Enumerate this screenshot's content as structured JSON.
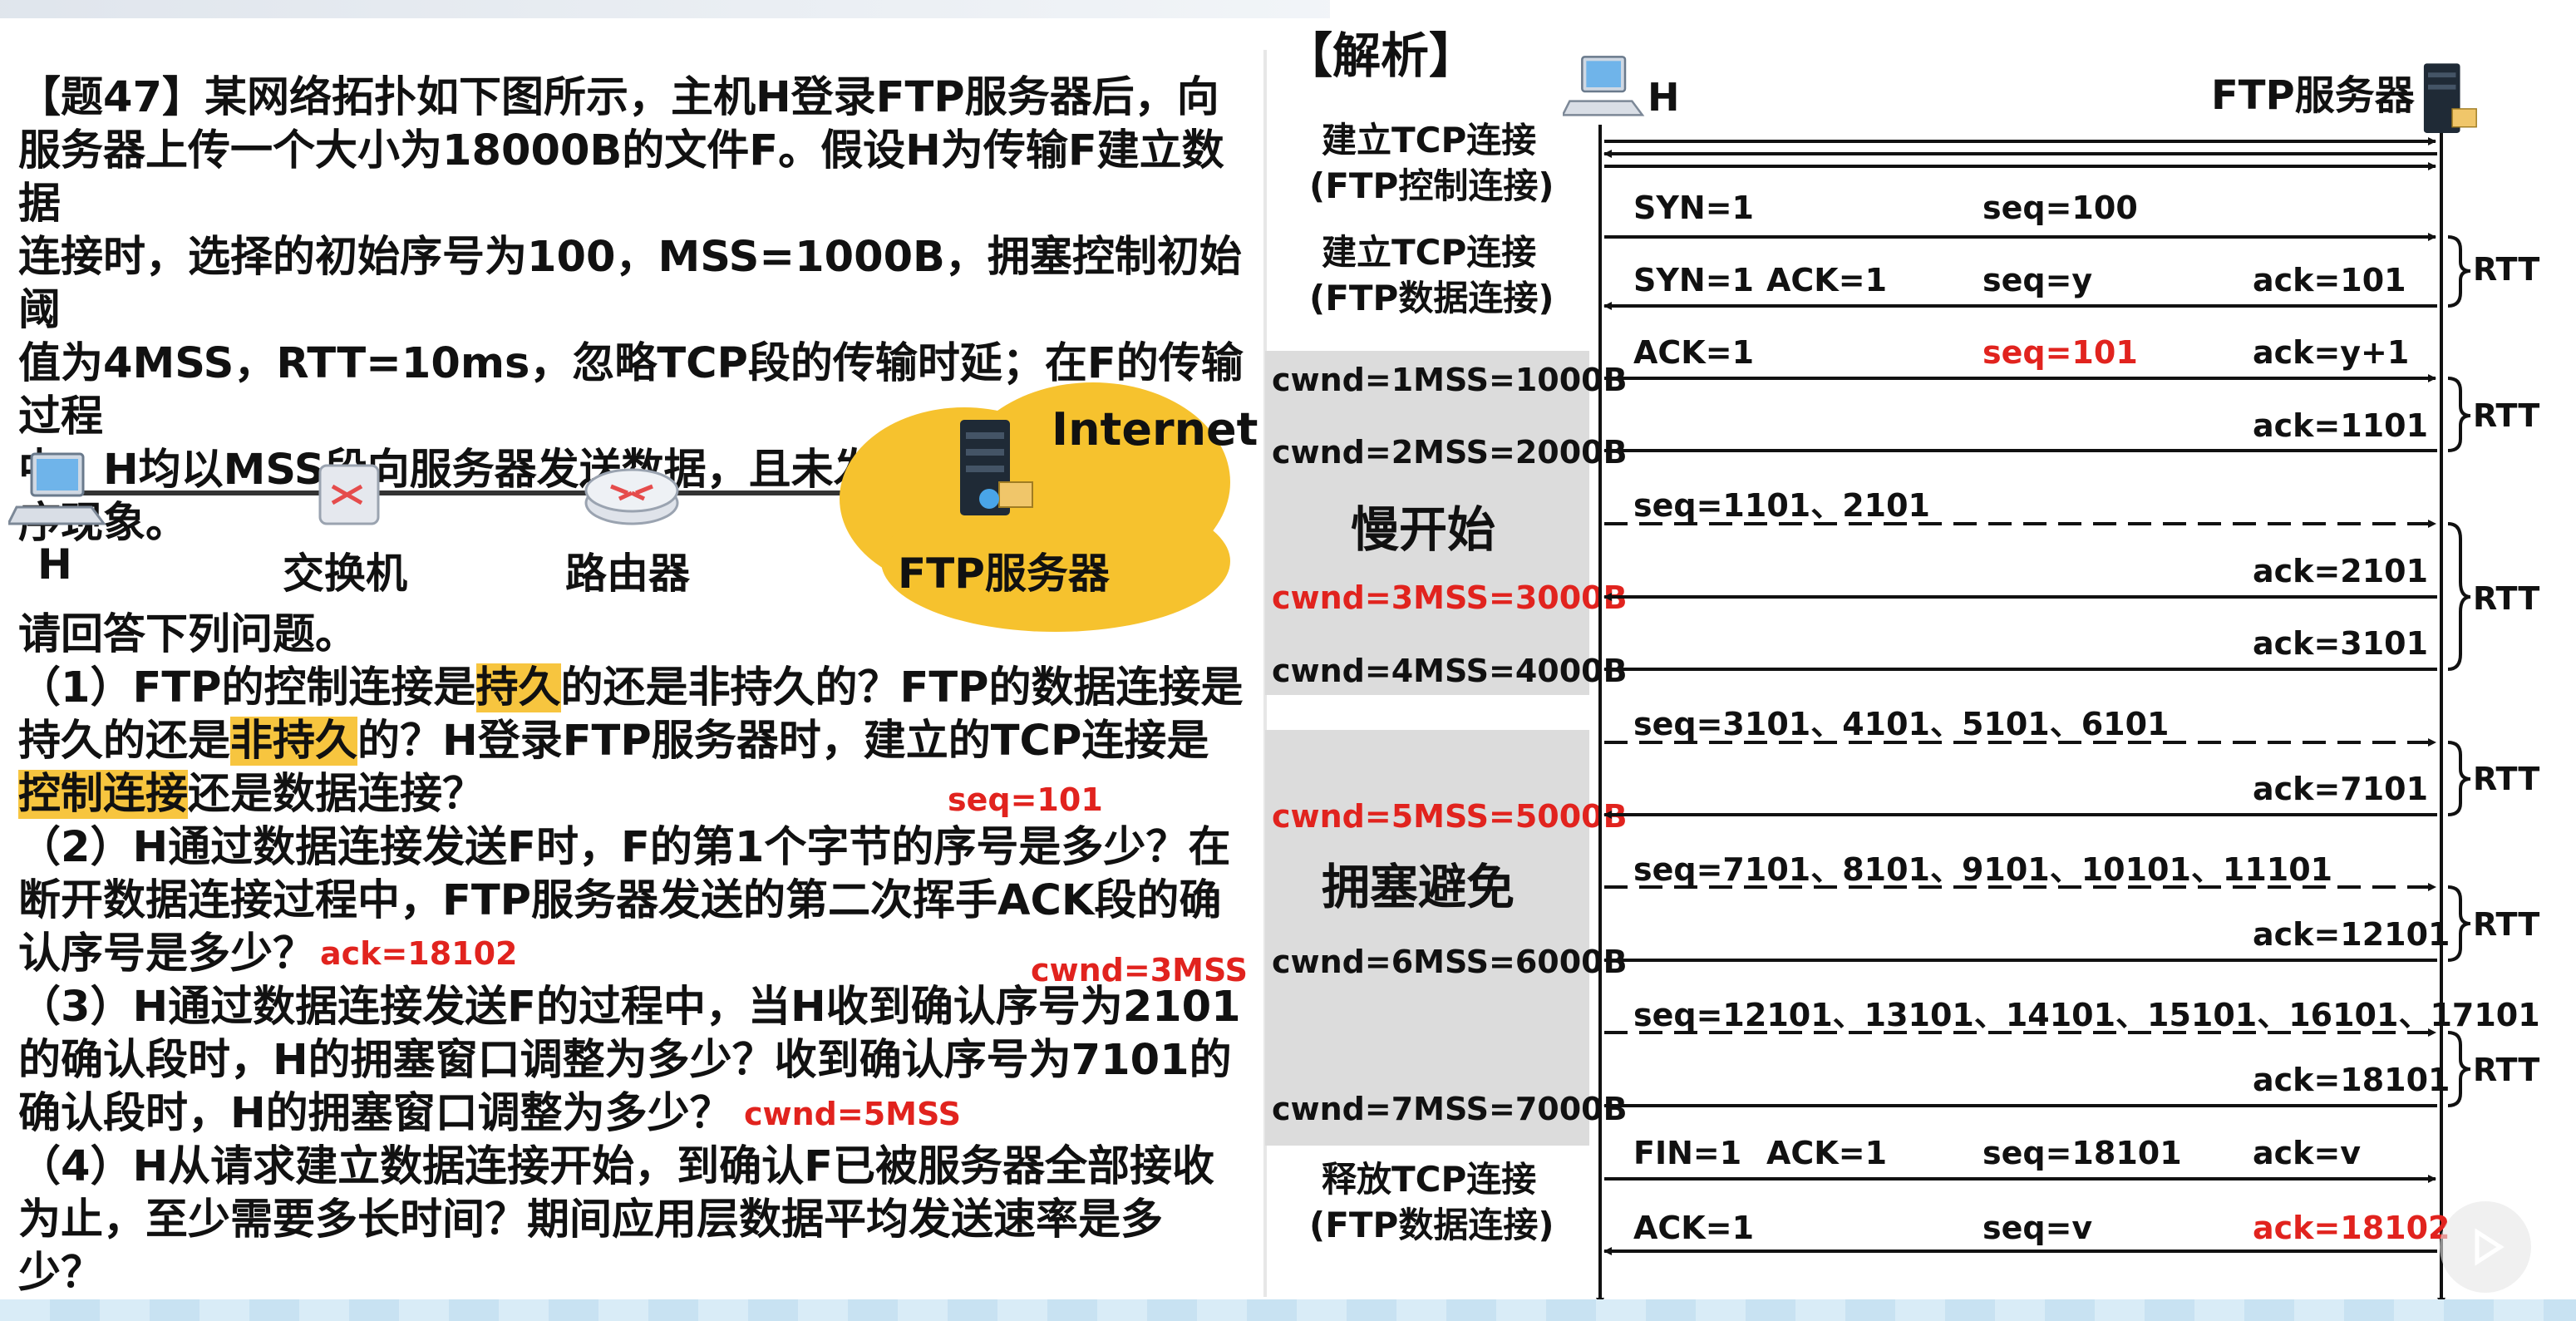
{
  "question": {
    "line1": "【题47】某网络拓扑如下图所示，主机H登录FTP服务器后，向",
    "line2": "服务器上传一个大小为18000B的文件F。假设H为传输F建立数据",
    "line3": "连接时，选择的初始序号为100，MSS=1000B，拥塞控制初始阈",
    "line4": "值为4MSS，RTT=10ms，忽略TCP段的传输时延；在F的传输过程",
    "line5": "中，H均以MSS段向服务器发送数据，且未发生差错、丢包和乱",
    "line6": "序现象。"
  },
  "topology": {
    "host_label": "H",
    "switch_label": "交换机",
    "router_label": "路由器",
    "internet_label": "Internet",
    "server_label": "FTP服务器"
  },
  "prompt": "请回答下列问题。",
  "q1": {
    "a": "（1）FTP的控制连接是",
    "b": "持久",
    "c": "的还是非持久的？FTP的数据连接是",
    "d": "持久的还是",
    "e": "非持久",
    "f": "的？H登录FTP服务器时，建立的TCP连接是",
    "g": "控制连接",
    "h": "还是数据连接？"
  },
  "q2": {
    "a": "（2）H通过数据连接发送F时，F的第1个字节的序号是多少？在",
    "b": "断开数据连接过程中，FTP服务器发送的第二次挥手ACK段的确",
    "c": "认序号是多少？"
  },
  "q3": {
    "a": "（3）H通过数据连接发送F的过程中，当H收到确认序号为2101",
    "b": "的确认段时，H的拥塞窗口调整为多少？收到确认序号为7101的",
    "c": "确认段时，H的拥塞窗口调整为多少？"
  },
  "q4": {
    "a": "（4）H从请求建立数据连接开始，到确认F已被服务器全部接收",
    "b": "为止，至少需要多长时间？期间应用层数据平均发送速率是多",
    "c": "少？"
  },
  "answers": {
    "seq": "seq=101",
    "ack": "ack=18102",
    "cwnd3": "cwnd=3MSS",
    "cwnd5": "cwnd=5MSS"
  },
  "analysis": {
    "title": "【解析】",
    "host": "H",
    "server": "FTP服务器",
    "ctrl_conn_1": "建立TCP连接",
    "ctrl_conn_2": "(FTP控制连接)",
    "data_conn_1": "建立TCP连接",
    "data_conn_2": "(FTP数据连接)",
    "release_1": "释放TCP连接",
    "release_2": "(FTP数据连接)",
    "slow_start": "慢开始",
    "cong_avoid": "拥塞避免",
    "rtt": "RTT",
    "cwnd": [
      "cwnd=1MSS=1000B",
      "cwnd=2MSS=2000B",
      "cwnd=3MSS=3000B",
      "cwnd=4MSS=4000B",
      "cwnd=5MSS=5000B",
      "cwnd=6MSS=6000B",
      "cwnd=7MSS=7000B"
    ],
    "messages": {
      "syn1": "SYN=1",
      "seq100": "seq=100",
      "syn_ack_syn": "SYN=1",
      "syn_ack_ack": "ACK=1",
      "syn_ack_seq": "seq=y",
      "syn_ack_ackno": "ack=101",
      "ack_ack": "ACK=1",
      "ack_seq": "seq=101",
      "ack_ackno": "ack=y+1",
      "ack1101": "ack=1101",
      "data2": "seq=1101、2101",
      "ack2101": "ack=2101",
      "ack3101": "ack=3101",
      "data4": "seq=3101、4101、5101、6101",
      "ack7101": "ack=7101",
      "data5": "seq=7101、8101、9101、10101、11101",
      "ack12101": "ack=12101",
      "data6": "seq=12101、13101、14101、15101、16101、17101",
      "ack18101": "ack=18101",
      "fin_fin": "FIN=1",
      "fin_ack": "ACK=1",
      "fin_seq": "seq=18101",
      "fin_ackno": "ack=v",
      "last_ack": "ACK=1",
      "last_seq": "seq=v",
      "last_ackno": "ack=18102"
    }
  },
  "colors": {
    "highlight": "#f7c53f",
    "red": "#e1231e",
    "cloud": "#f6c22e",
    "gray": "#dcdcdc"
  }
}
